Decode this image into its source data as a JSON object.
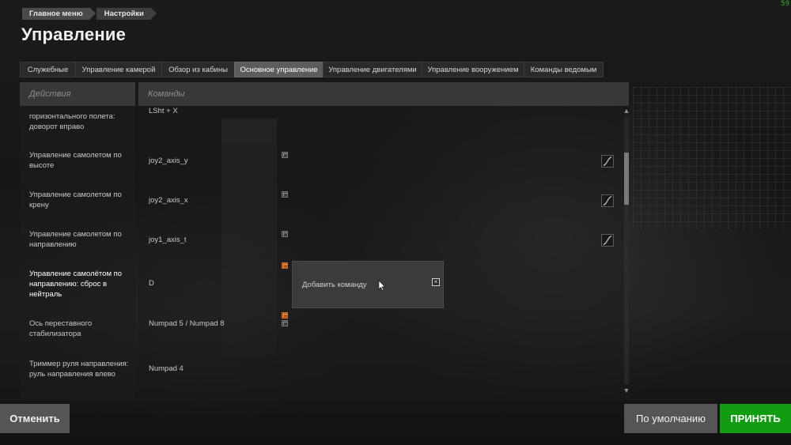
{
  "fps": "59",
  "breadcrumb": [
    "Главное меню",
    "Настройки"
  ],
  "page_title": "Управление",
  "tabs": [
    {
      "label": "Служебные",
      "width": 70
    },
    {
      "label": "Управление камерой",
      "width": 109
    },
    {
      "label": "Обзор из кабины",
      "width": 92
    },
    {
      "label": "Основное управление",
      "width": 112
    },
    {
      "label": "Управление двигателями",
      "width": 125
    },
    {
      "label": "Управление вооружением",
      "width": 129
    },
    {
      "label": "Команды ведомым",
      "width": 101
    }
  ],
  "active_tab": 3,
  "table": {
    "header_actions": "Действия",
    "header_commands": "Команды",
    "rows": [
      {
        "action": "горизонтального полета: доворот вправо",
        "command": "LSht + X"
      },
      {
        "action": "Управление самолетом по высоте",
        "command": "joy2_axis_y"
      },
      {
        "action": "Управление самолетом по крену",
        "command": "joy2_axis_x"
      },
      {
        "action": "Управление самолетом по направлению",
        "command": "joy1_axis_t"
      },
      {
        "action": "Управление самолётом по направлению: сброс в нейтраль",
        "command": "D"
      },
      {
        "action": "Ось переставного стабилизатора",
        "command": "Numpad 5 / Numpad 8"
      },
      {
        "action": "Триммер руля направления: руль направления влево",
        "command": "Numpad 4"
      }
    ]
  },
  "popup": {
    "label": "Добавить команду",
    "close_symbol": "×"
  },
  "buttons": {
    "cancel": "Отменить",
    "default": "По умолчанию",
    "accept": "ПРИНЯТЬ"
  },
  "colors": {
    "accept_green": "#129c12",
    "active_tab": "#5c5c5c",
    "edit_orange": "#d6701f"
  }
}
